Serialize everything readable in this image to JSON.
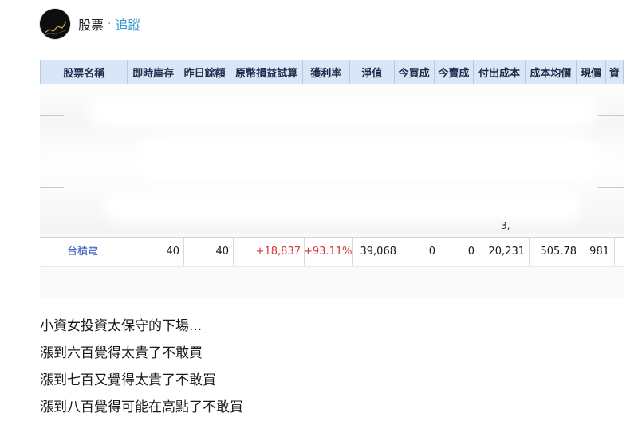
{
  "board": {
    "name": "股票",
    "separator": "·",
    "follow_label": "追蹤"
  },
  "table": {
    "headers": [
      "股票名稱",
      "即時庫存",
      "昨日餘額",
      "原幣損益試算",
      "獲利率",
      "淨值",
      "今買成",
      "今賣成",
      "付出成本",
      "成本均價",
      "現價",
      "資"
    ],
    "row": {
      "name": "台積電",
      "inventory": "40",
      "prev_balance": "40",
      "pnl": "+18,837",
      "return_rate": "+93.11%",
      "net_value": "39,068",
      "today_buy": "0",
      "today_sell": "0",
      "cost": "20,231",
      "avg_cost": "505.78",
      "price": "981"
    },
    "partial_text": "3,"
  },
  "post_lines": [
    "小資女投資太保守的下場...",
    "漲到六百覺得太貴了不敢買",
    "漲到七百又覺得太貴了不敢買",
    "漲到八百覺得可能在高點了不敢買"
  ],
  "colors": {
    "link": "#3397cf",
    "header_bg": "#d8e6f8",
    "profit_red": "#d9363e",
    "stock_name": "#2b52b5"
  }
}
